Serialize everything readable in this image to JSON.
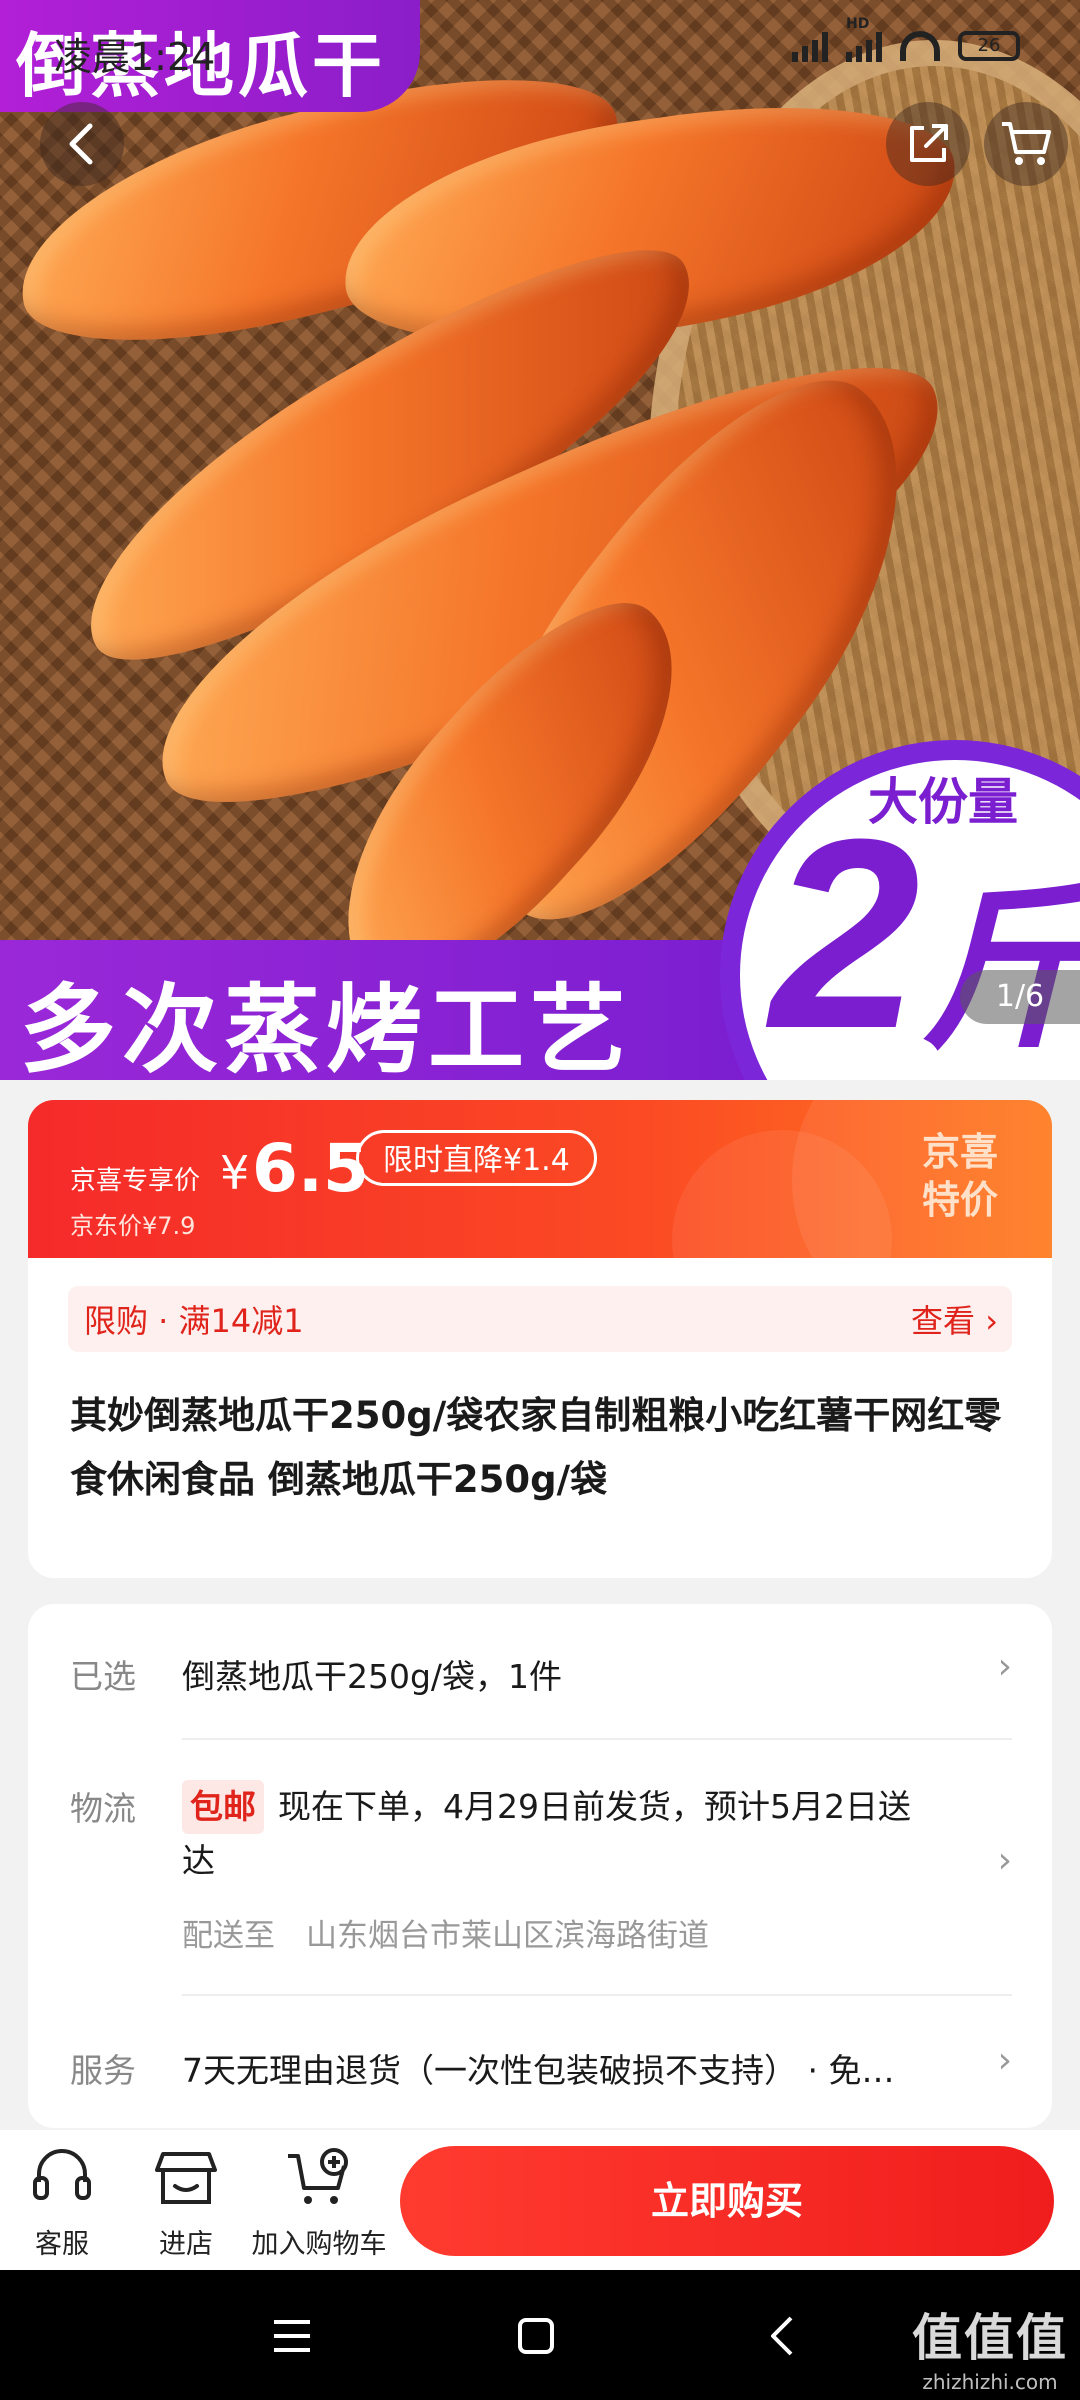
{
  "status_bar": {
    "time": "凌晨1:24",
    "network": "HD",
    "battery": "26"
  },
  "hero": {
    "image_title": "倒蒸地瓜干",
    "banner_text": "多次蒸烤工艺",
    "amount_label": "大份量",
    "amount_value": "2",
    "amount_unit": "斤",
    "page_counter": "1/6"
  },
  "header_icons": {
    "back": "back-icon",
    "share": "share-icon",
    "cart": "cart-icon"
  },
  "price": {
    "label": "京喜专享价",
    "currency": "¥",
    "amount": "6.5",
    "discount_tag": "限时直降¥1.4",
    "jd_price": "京东价¥7.9",
    "badge": "京喜特价"
  },
  "promo": {
    "text": "限购 · 满14减1",
    "view_label": "查看 ›"
  },
  "product": {
    "title": "其妙倒蒸地瓜干250g/袋农家自制粗粮小吃红薯干网红零食休闲食品 倒蒸地瓜干250g/袋"
  },
  "specs": {
    "selected_label": "已选",
    "selected_value": "倒蒸地瓜干250g/袋，1件",
    "logistics_label": "物流",
    "free_shipping": "包邮",
    "logistics_value": "现在下单，4月29日前发货，预计5月2日送达",
    "delivery_to": "配送至　山东烟台市莱山区滨海路街道",
    "service_label": "服务",
    "service_value": "7天无理由退货（一次性包装破损不支持） · 免…"
  },
  "action_bar": {
    "customer_service": "客服",
    "store": "进店",
    "add_to_cart": "加入购物车",
    "buy_now": "立即购买"
  },
  "watermark": {
    "big": "值值值",
    "small": "zhizhizhi.com"
  },
  "colors": {
    "accent_red": "#f01d1d",
    "promo_purple": "#7a1ed0"
  }
}
